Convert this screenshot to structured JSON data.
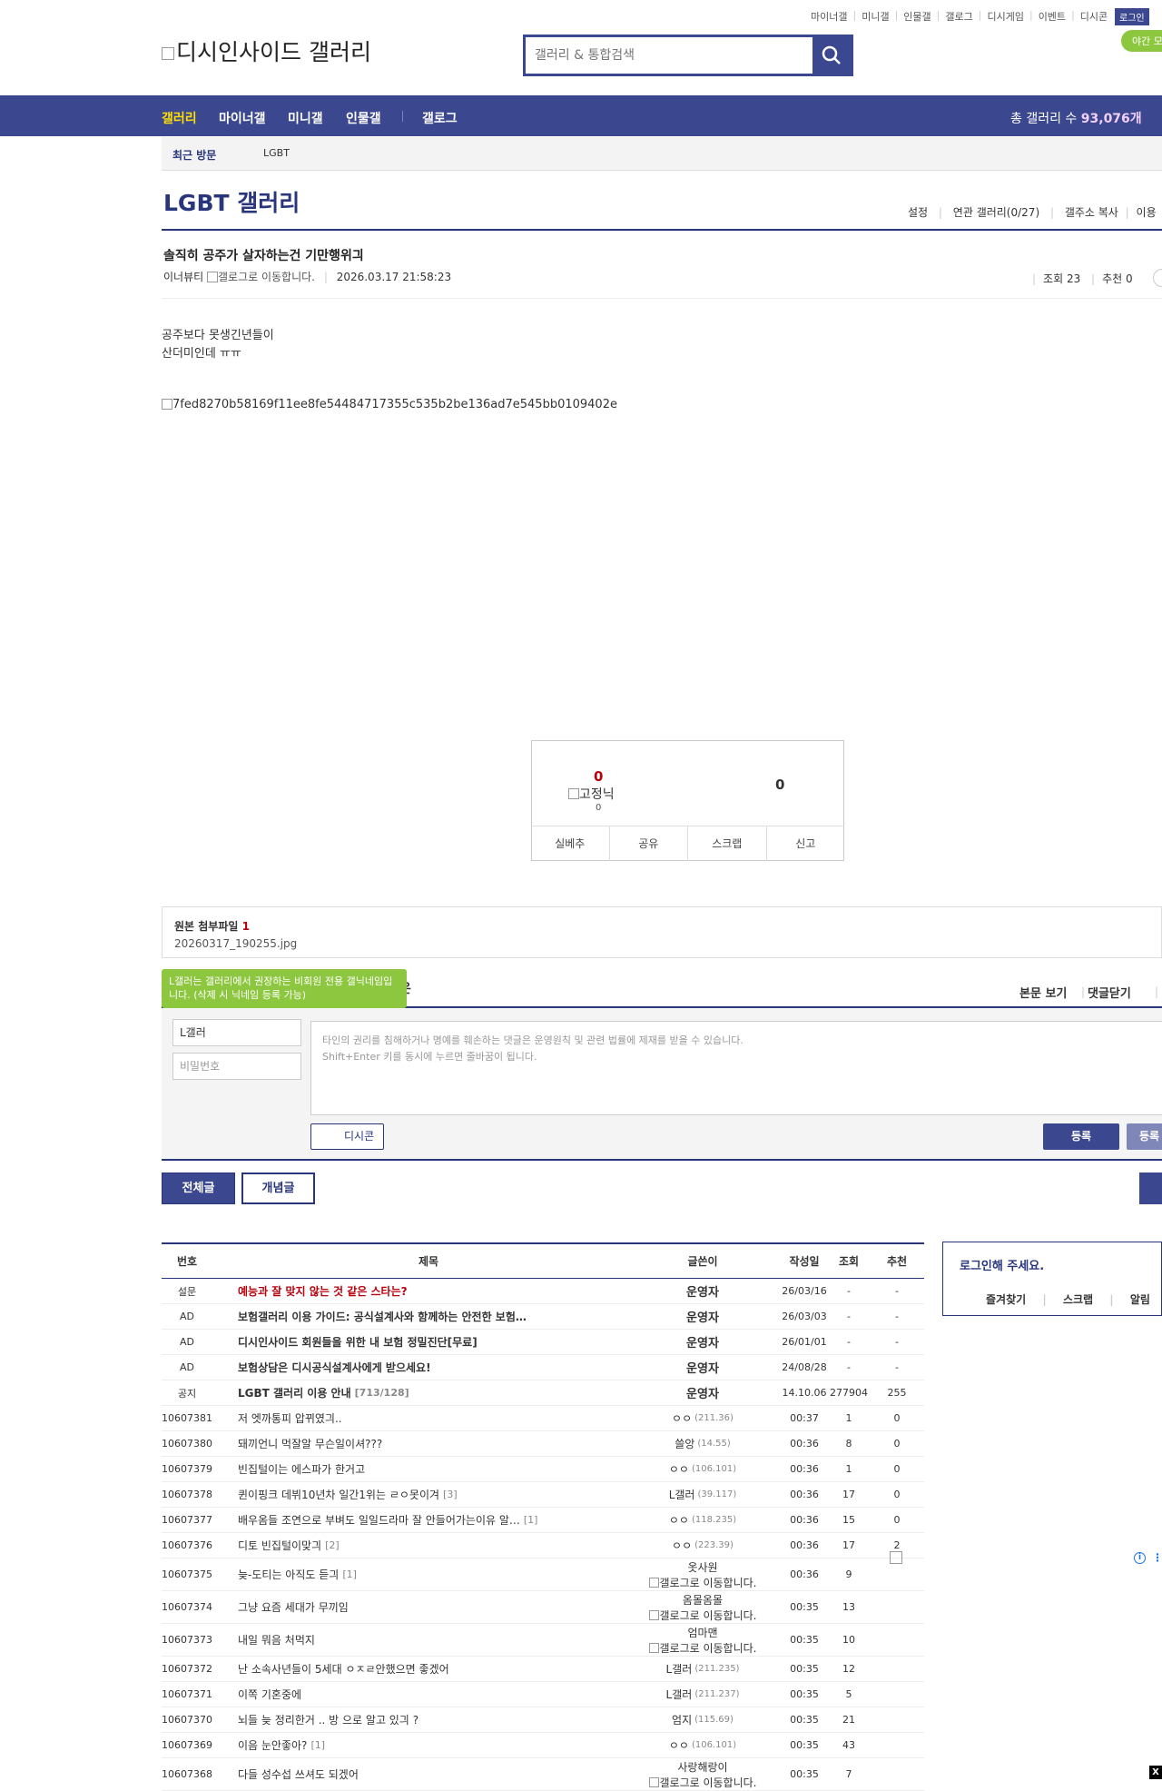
{
  "top_links": [
    "마이너갤",
    "미니갤",
    "인물갤",
    "갤로그",
    "디시게임",
    "이벤트",
    "디시콘"
  ],
  "login_label": "로그인",
  "night_label": "야간 모",
  "logo_alt": "디시인사이드 갤러리",
  "search": {
    "placeholder": "갤러리 & 통합검색"
  },
  "nav": {
    "items": [
      "갤러리",
      "마이너갤",
      "미니갤",
      "인물갤",
      "갤로그"
    ],
    "count_label": "총 갤러리 수",
    "count_value": "93,076개"
  },
  "recent": {
    "label": "최근 방문",
    "item": "LGBT"
  },
  "gallery": {
    "title": "LGBT 갤러리",
    "links": [
      "설정",
      "연관 갤러리(0/27)",
      "갤주소 복사",
      "이용"
    ]
  },
  "post": {
    "title": "솔직히 공주가 살자하는건 기만행위긔",
    "author": "이너뷰티",
    "author_icon_alt": "갤로그로 이동합니다.",
    "date": "2026.03.17 21:58:23",
    "views": "조회 23",
    "recommends": "추천 0",
    "body": [
      "공주보다 못생긴년들이",
      "산더미인데 ㅠㅠ"
    ],
    "image_alt": "7fed8270b58169f11ee8fe54484717355c535b2be136ad7e545bb0109402e"
  },
  "vote": {
    "up": "0",
    "fixed_alt": "고정닉",
    "fixed_count": "0",
    "down": "0",
    "buttons": [
      "실베추",
      "공유",
      "스크랩",
      "신고"
    ]
  },
  "attach": {
    "label": "원본 첨부파일",
    "count": "1",
    "file": "20260317_190255.jpg"
  },
  "comment": {
    "tooltip": "L갤러는 갤러리에서 권장하는 비회원 전용 갤닉네임입니다. (삭제 시 닉네임 등록 가능)",
    "title_tail": "은",
    "view_body": "본문 보기",
    "close_comments": "댓글닫기",
    "nick_value": "L갤러",
    "password_placeholder": "비밀번호",
    "text_line1": "타인의 권리를 침해하거나 명예를 훼손하는 댓글은 운영원칙 및 관련 법률에 제재를 받을 수 있습니다.",
    "text_line2": "Shift+Enter 키를 동시에 누르면 줄바꿈이 됩니다.",
    "dccon": "디시콘",
    "submit": "등록",
    "submit2": "등록"
  },
  "tabs": {
    "all": "전체글",
    "concept": "개념글"
  },
  "list": {
    "headers": [
      "번호",
      "제목",
      "글쓴이",
      "작성일",
      "조회",
      "추천"
    ],
    "rows": [
      {
        "num": "설문",
        "subject": "예능과 잘 맞지 않는 것 같은 스타는?",
        "style": "red",
        "writer": "운영자",
        "ip": "",
        "date": "26/03/16",
        "views": "-",
        "rec": "-"
      },
      {
        "num": "AD",
        "subject": "보험갤러리 이용 가이드: 공식설계사와 함께하는 안전한 보험…",
        "style": "bold",
        "writer": "운영자",
        "ip": "",
        "date": "26/03/03",
        "views": "-",
        "rec": "-"
      },
      {
        "num": "AD",
        "subject": "디시인사이드 회원들을 위한 내 보험 정밀진단[무료]",
        "style": "bold",
        "writer": "운영자",
        "ip": "",
        "date": "26/01/01",
        "views": "-",
        "rec": "-"
      },
      {
        "num": "AD",
        "subject": "보험상담은 디시공식설계사에게 받으세요!",
        "style": "bold",
        "writer": "운영자",
        "ip": "",
        "date": "24/08/28",
        "views": "-",
        "rec": "-"
      },
      {
        "num": "공지",
        "subject": "LGBT 갤러리 이용 안내",
        "cnt": "[713/128]",
        "style": "bold",
        "writer": "운영자",
        "ip": "",
        "date": "14.10.06",
        "views": "277904",
        "rec": "255"
      },
      {
        "num": "10607381",
        "subject": "저 엣까통피 압뀌였긔..",
        "writer": "ㅇㅇ",
        "ip": "(211.36)",
        "date": "00:37",
        "views": "1",
        "rec": "0"
      },
      {
        "num": "10607380",
        "subject": "돼끼언니 먹잘알 무슨일이셔???",
        "writer": "쓸앙",
        "ip": "(14.55)",
        "date": "00:36",
        "views": "8",
        "rec": "0"
      },
      {
        "num": "10607379",
        "subject": "빈집털이는 에스파가 한거고",
        "writer": "ㅇㅇ",
        "ip": "(106.101)",
        "date": "00:36",
        "views": "1",
        "rec": "0"
      },
      {
        "num": "10607378",
        "subject": "퀸이핑크 데뷔10년차 일간1위는 ㄹㅇ못이겨",
        "cnt": "[3]",
        "writer": "L갤러",
        "ip": "(39.117)",
        "date": "00:36",
        "views": "17",
        "rec": "0"
      },
      {
        "num": "10607377",
        "subject": "배우옴들 조연으로 부벼도 일일드라마 잘 안들어가는이유 알…",
        "cnt": "[1]",
        "writer": "ㅇㅇ",
        "ip": "(118.235)",
        "date": "00:36",
        "views": "15",
        "rec": "0"
      },
      {
        "num": "10607376",
        "subject": "디토 빈집털이맞긔",
        "cnt": "[2]",
        "writer": "ㅇㅇ",
        "ip": "(223.39)",
        "date": "00:36",
        "views": "17",
        "rec": "2"
      },
      {
        "num": "10607375",
        "subject": "늦-도티는 아직도 듣긔",
        "cnt": "[1]",
        "writer": "옷사원",
        "gallog": "갤로그로 이동합니다.",
        "tall": true,
        "date": "00:36",
        "views": "9",
        "rec": ""
      },
      {
        "num": "10607374",
        "subject": "그냥 요즘 세대가 무끼임",
        "writer": "옴몰옴몰",
        "gallog": "갤로그로 이동합니다.",
        "tall": true,
        "date": "00:35",
        "views": "13",
        "rec": ""
      },
      {
        "num": "10607373",
        "subject": "내일 뭐음 처먹지",
        "writer": "엄마맨",
        "gallog": "갤로그로 이동합니다.",
        "tall": true,
        "date": "00:35",
        "views": "10",
        "rec": ""
      },
      {
        "num": "10607372",
        "subject": "난 소속사년들이 5세대 ㅇㅈㄹ안했으면 좋겠어",
        "writer": "L갤러",
        "ip": "(211.235)",
        "date": "00:35",
        "views": "12",
        "rec": ""
      },
      {
        "num": "10607371",
        "subject": "이쪽 기혼중에",
        "writer": "L갤러",
        "ip": "(211.237)",
        "date": "00:35",
        "views": "5",
        "rec": ""
      },
      {
        "num": "10607370",
        "subject": "뇌들 늦 정리한거 .. 방 으로 알고 있긔 ?",
        "writer": "엄지",
        "ip": "(115.69)",
        "date": "00:35",
        "views": "21",
        "rec": ""
      },
      {
        "num": "10607369",
        "subject": "이음 눈안좋아?",
        "cnt": "[1]",
        "writer": "ㅇㅇ",
        "ip": "(106.101)",
        "date": "00:35",
        "views": "43",
        "rec": ""
      },
      {
        "num": "10607368",
        "subject": "다들 성수섭 쓰셔도 되겠어",
        "writer": "사랑해랑이",
        "gallog": "갤로그로 이동합니다.",
        "tall": true,
        "date": "00:35",
        "views": "7",
        "rec": ""
      }
    ]
  },
  "login_panel": {
    "title": "로그인해 주세요.",
    "links": [
      "즐겨찾기",
      "스크랩",
      "알림"
    ]
  },
  "colors": {
    "brand": "#3b4890",
    "brand_dark": "#29367c",
    "accent_green": "#8dc63f",
    "nav_active": "#ffdd00"
  }
}
